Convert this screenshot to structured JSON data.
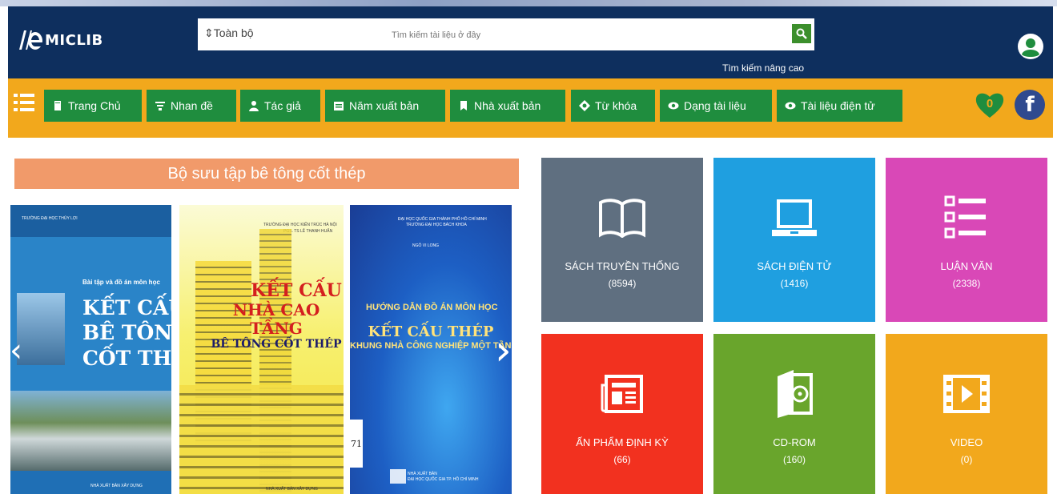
{
  "header": {
    "logo_text": "MICLIB",
    "search_scope": "Toàn bộ",
    "search_placeholder": "Tìm kiếm tài liệu ở đây",
    "advanced_search": "Tìm kiếm nâng cao"
  },
  "nav": {
    "items": [
      {
        "label": "Trang Chủ",
        "icon": "home-icon"
      },
      {
        "label": "Nhan đề",
        "icon": "title-icon"
      },
      {
        "label": "Tác giả",
        "icon": "author-icon"
      },
      {
        "label": "Năm xuất bản",
        "icon": "calendar-icon"
      },
      {
        "label": "Nhà xuất bản",
        "icon": "bookmark-icon"
      },
      {
        "label": "Từ khóa",
        "icon": "keyword-icon"
      },
      {
        "label": "Dạng tài liệu",
        "icon": "eye-icon"
      },
      {
        "label": "Tài liệu điện tử",
        "icon": "eye-icon"
      }
    ],
    "favorites_count": "0",
    "facebook_letter": "f"
  },
  "collection": {
    "title": "Bộ sưu tập bê tông cốt thép",
    "books": [
      {
        "header": "TRƯỜNG ĐẠI HỌC THỦY LỢI",
        "subtitle": "Bài tập và đồ án môn học",
        "title_lines": [
          "KẾT CẤU",
          "BÊ TÔNG",
          "CỐT THÉP"
        ],
        "publisher": "NHÀ XUẤT BẢN XÂY DỰNG"
      },
      {
        "header": "TRƯỜNG ĐẠI HỌC KIẾN TRÚC HÀ NỘI",
        "author": "PGS. TS LÊ THANH HUẤN",
        "title_lines": [
          "KẾT CẤU",
          "NHÀ CAO TẦNG",
          "BÊ TÔNG CỐT THÉP"
        ],
        "publisher": "NHÀ XUẤT BẢN XÂY DỰNG"
      },
      {
        "header": "ĐẠI HỌC QUỐC GIA THÀNH PHỐ HỒ CHÍ MINH",
        "header2": "TRƯỜNG ĐẠI HỌC BÁCH KHOA",
        "author": "NGÔ VI LONG",
        "subtitle": "HƯỚNG DẪN ĐỒ ÁN MÔN HỌC",
        "title_lines": [
          "KẾT CẤU THÉP",
          "KHUNG NHÀ CÔNG NGHIỆP MỘT TẦNG"
        ],
        "publisher_lines": [
          "NHÀ XUẤT BẢN",
          "ĐẠI HỌC QUỐC GIA TP. HỒ CHÍ MINH"
        ],
        "stamp_number": "71"
      }
    ]
  },
  "categories": [
    {
      "label": "SÁCH TRUYỀN THỐNG",
      "count": "(8594)",
      "color": "#5f6f80",
      "icon": "book-icon"
    },
    {
      "label": "SÁCH ĐIỆN TỬ",
      "count": "(1416)",
      "color": "#1f9fe0",
      "icon": "laptop-icon"
    },
    {
      "label": "LUẬN VĂN",
      "count": "(2338)",
      "color": "#d948b7",
      "icon": "list-icon"
    },
    {
      "label": "ẤN PHẨM ĐỊNH KỲ",
      "count": "(66)",
      "color": "#f2311f",
      "icon": "newspaper-icon"
    },
    {
      "label": "CD-ROM",
      "count": "(160)",
      "color": "#69a52c",
      "icon": "cd-icon"
    },
    {
      "label": "VIDEO",
      "count": "(0)",
      "color": "#f2a81c",
      "icon": "video-icon"
    }
  ],
  "colors": {
    "header_bg": "#0e2f5e",
    "navbar_bg": "#f2a81c",
    "nav_button": "#1f8d3e",
    "collection_title_bg": "#f19a6a"
  }
}
